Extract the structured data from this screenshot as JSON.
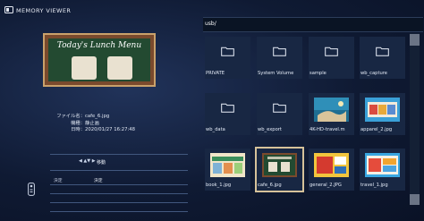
{
  "app": {
    "title": "MEMORY VIEWER"
  },
  "preview": {
    "title": "Today's Lunch Menu"
  },
  "file_info": [
    {
      "key": "ファイル名：",
      "value": "cafe_6.jpg"
    },
    {
      "key": "機種：",
      "value": "静止画"
    },
    {
      "key": "日時：",
      "value": "2020/01/27 16:27:48"
    }
  ],
  "help": {
    "nav_glyph": "◀ ▲▼ ▶",
    "nav_label": "移動",
    "ok_key": "決定",
    "ok_label": "決定"
  },
  "browser": {
    "path": "usb/",
    "items": [
      {
        "name": "PRIVATE",
        "kind": "folder"
      },
      {
        "name": "System Volume",
        "kind": "folder"
      },
      {
        "name": "sample",
        "kind": "folder"
      },
      {
        "name": "wb_capture",
        "kind": "folder"
      },
      {
        "name": "wb_data",
        "kind": "folder"
      },
      {
        "name": "wb_export",
        "kind": "folder"
      },
      {
        "name": "4K-HD-travel.m",
        "kind": "image"
      },
      {
        "name": "apparel_2.jpg",
        "kind": "image"
      },
      {
        "name": "book_1.jpg",
        "kind": "image"
      },
      {
        "name": "cafe_6.jpg",
        "kind": "image",
        "selected": true
      },
      {
        "name": "general_2.JPG",
        "kind": "image"
      },
      {
        "name": "travel_1.jpg",
        "kind": "image"
      }
    ]
  },
  "colors": {
    "accent": "#d6c29a",
    "tile": "#182743",
    "background": "#0f1a33"
  }
}
